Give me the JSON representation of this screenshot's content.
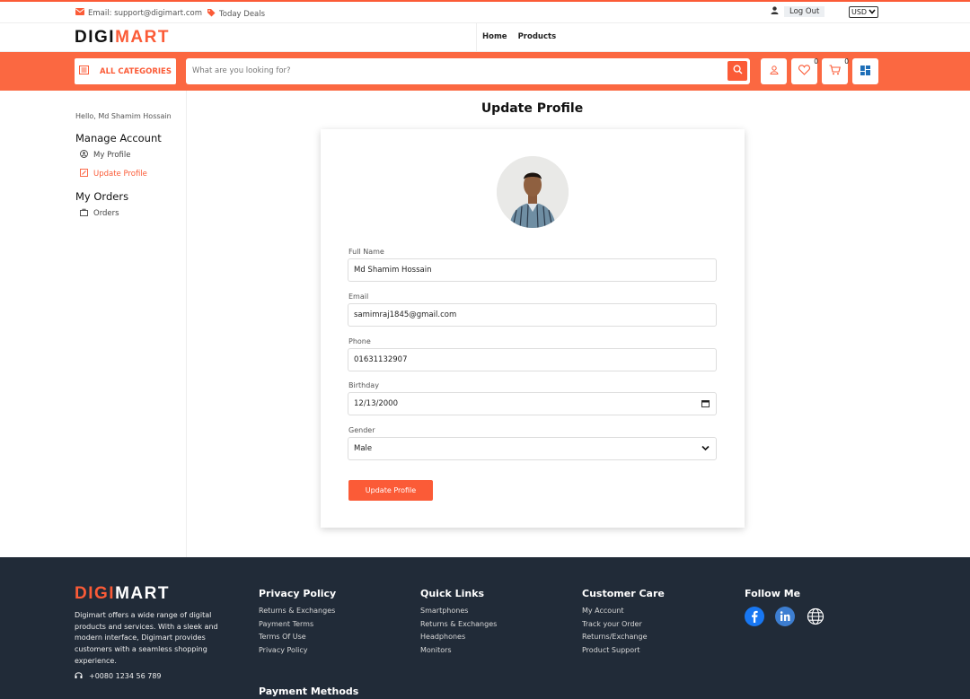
{
  "topbar": {
    "email": "Email: support@digimart.com",
    "deals": "Today Deals",
    "logout": "Log Out",
    "currency": "USD"
  },
  "brand": {
    "part1": "DIGI",
    "part2": "MART"
  },
  "nav": {
    "home": "Home",
    "products": "Products"
  },
  "search": {
    "all_categories": "ALL CATEGORIES",
    "placeholder": "What are you looking for?",
    "wishlist_count": "0",
    "cart_count": "0"
  },
  "sidebar": {
    "hello": "Hello, Md Shamim Hossain",
    "manage_account": "Manage Account",
    "my_profile": "My Profile",
    "update_profile": "Update Profile",
    "my_orders": "My Orders",
    "orders": "Orders"
  },
  "page": {
    "title": "Update Profile"
  },
  "form": {
    "full_name_label": "Full Name",
    "full_name": "Md Shamim Hossain",
    "email_label": "Email",
    "email": "samimraj1845@gmail.com",
    "phone_label": "Phone",
    "phone": "01631132907",
    "birthday_label": "Birthday",
    "birthday": "12/13/2000",
    "gender_label": "Gender",
    "gender": "Male",
    "submit": "Update Profile"
  },
  "footer": {
    "description": "Digimart offers a wide range of digital products and services. With a sleek and modern interface, Digimart provides customers with a seamless shopping experience.",
    "phone": "+0080 1234 56 789",
    "privacy": {
      "title": "Privacy Policy",
      "links": [
        "Returns & Exchanges",
        "Payment Terms",
        "Terms Of Use",
        "Privacy Policy"
      ]
    },
    "quick": {
      "title": "Quick Links",
      "links": [
        "Smartphones",
        "Returns & Exchanges",
        "Headphones",
        "Monitors"
      ]
    },
    "care": {
      "title": "Customer Care",
      "links": [
        "My Account",
        "Track your Order",
        "Returns/Exchange",
        "Product Support"
      ]
    },
    "follow": {
      "title": "Follow Me"
    },
    "payment": "Payment Methods"
  },
  "colors": {
    "accent": "#fb5b37",
    "footer_bg": "#212b38"
  },
  "icons": [
    "mail-icon",
    "tag-icon",
    "user-icon",
    "grid-list-icon",
    "search-icon",
    "heart-icon",
    "cart-icon",
    "dashboard-icon",
    "user-circle-icon",
    "edit-icon",
    "bag-icon",
    "headset-icon",
    "facebook-icon",
    "linkedin-icon",
    "globe-icon",
    "calendar-icon",
    "chevron-down-icon"
  ]
}
